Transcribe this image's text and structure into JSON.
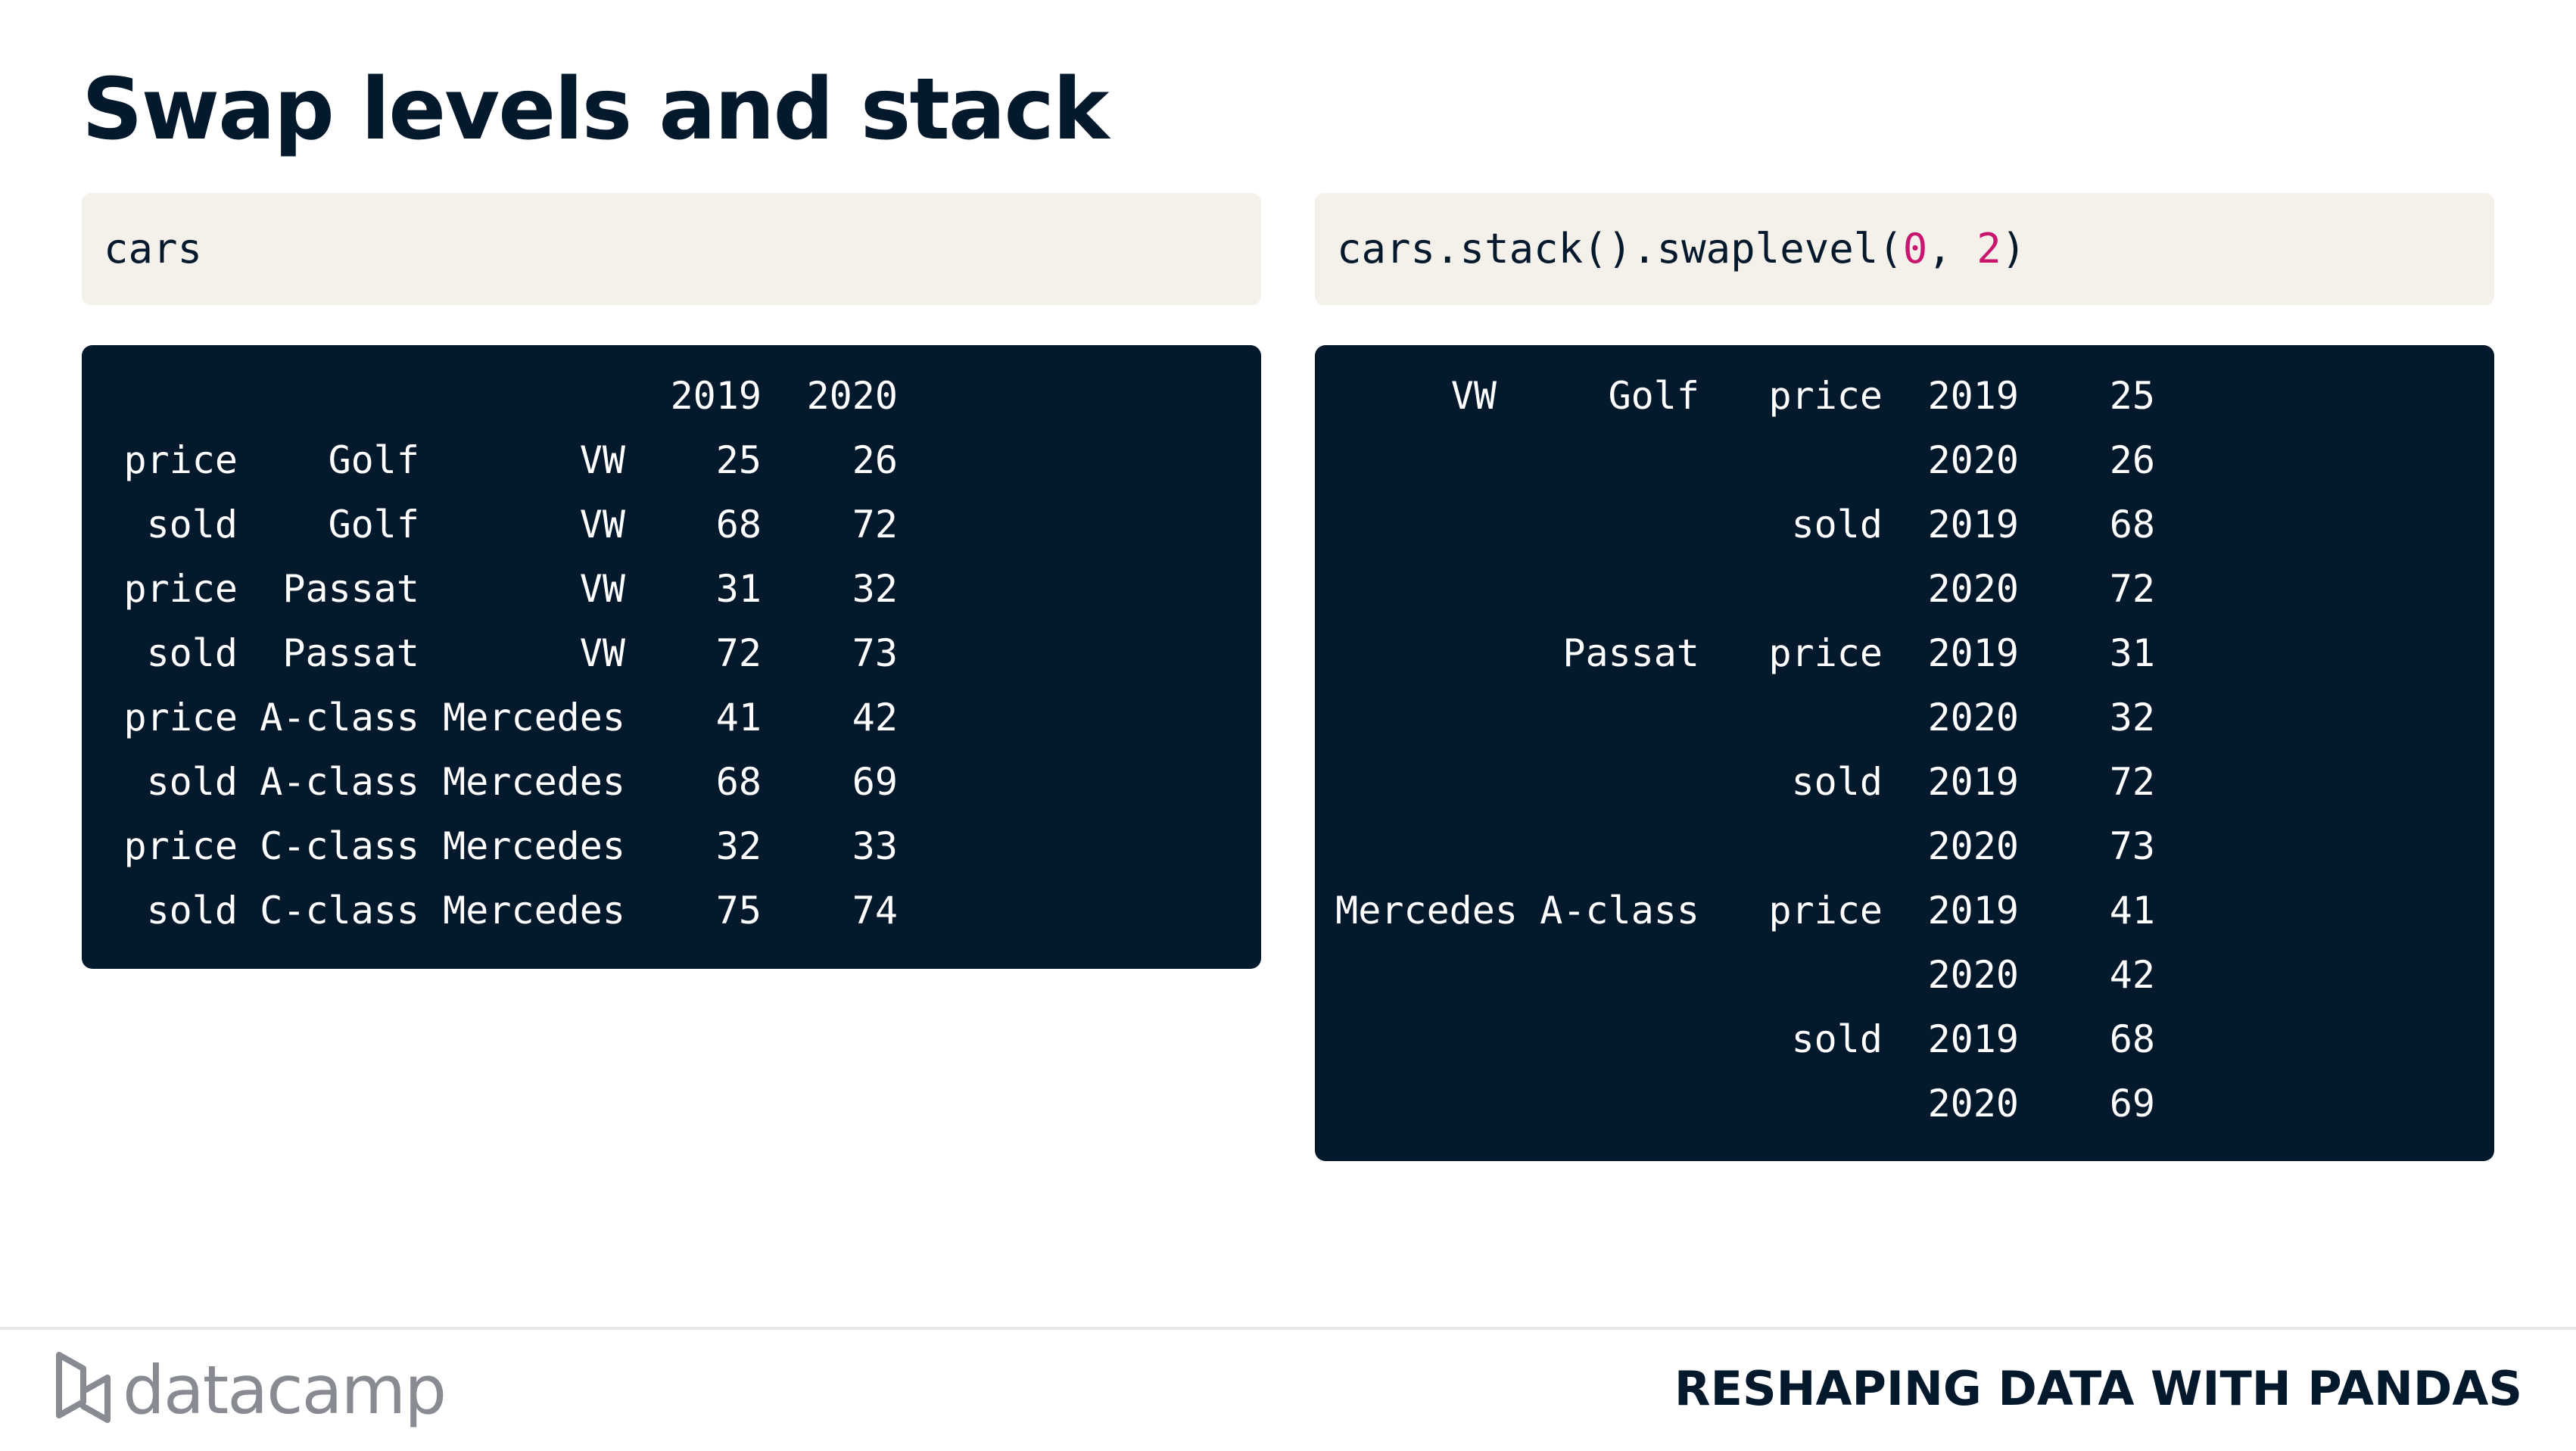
{
  "slide": {
    "title": "Swap levels and stack",
    "footer_course": "RESHAPING DATA WITH PANDAS",
    "logo_text": "datacamp"
  },
  "left_code": {
    "text": "cars"
  },
  "right_code": {
    "prefix": "cars.stack().swaplevel(",
    "arg1": "0",
    "sep": ", ",
    "arg2": "2",
    "suffix": ")"
  },
  "left_output": {
    "header": [
      "2019",
      "2020"
    ],
    "rows": [
      {
        "l0": "price",
        "l1": "Golf",
        "l2": "VW",
        "v2019": "25",
        "v2020": "26"
      },
      {
        "l0": "sold",
        "l1": "Golf",
        "l2": "VW",
        "v2019": "68",
        "v2020": "72"
      },
      {
        "l0": "price",
        "l1": "Passat",
        "l2": "VW",
        "v2019": "31",
        "v2020": "32"
      },
      {
        "l0": "sold",
        "l1": "Passat",
        "l2": "VW",
        "v2019": "72",
        "v2020": "73"
      },
      {
        "l0": "price",
        "l1": "A-class",
        "l2": "Mercedes",
        "v2019": "41",
        "v2020": "42"
      },
      {
        "l0": "sold",
        "l1": "A-class",
        "l2": "Mercedes",
        "v2019": "68",
        "v2020": "69"
      },
      {
        "l0": "price",
        "l1": "C-class",
        "l2": "Mercedes",
        "v2019": "32",
        "v2020": "33"
      },
      {
        "l0": "sold",
        "l1": "C-class",
        "l2": "Mercedes",
        "v2019": "75",
        "v2020": "74"
      }
    ]
  },
  "right_output": {
    "rows": [
      {
        "brand": "VW",
        "model": "Golf",
        "metric": "price",
        "year": "2019",
        "value": "25"
      },
      {
        "brand": "",
        "model": "",
        "metric": "",
        "year": "2020",
        "value": "26"
      },
      {
        "brand": "",
        "model": "",
        "metric": "sold",
        "year": "2019",
        "value": "68"
      },
      {
        "brand": "",
        "model": "",
        "metric": "",
        "year": "2020",
        "value": "72"
      },
      {
        "brand": "",
        "model": "Passat",
        "metric": "price",
        "year": "2019",
        "value": "31"
      },
      {
        "brand": "",
        "model": "",
        "metric": "",
        "year": "2020",
        "value": "32"
      },
      {
        "brand": "",
        "model": "",
        "metric": "sold",
        "year": "2019",
        "value": "72"
      },
      {
        "brand": "",
        "model": "",
        "metric": "",
        "year": "2020",
        "value": "73"
      },
      {
        "brand": "Mercedes",
        "model": "A-class",
        "metric": "price",
        "year": "2019",
        "value": "41"
      },
      {
        "brand": "",
        "model": "",
        "metric": "",
        "year": "2020",
        "value": "42"
      },
      {
        "brand": "",
        "model": "",
        "metric": "sold",
        "year": "2019",
        "value": "68"
      },
      {
        "brand": "",
        "model": "",
        "metric": "",
        "year": "2020",
        "value": "69"
      }
    ]
  }
}
